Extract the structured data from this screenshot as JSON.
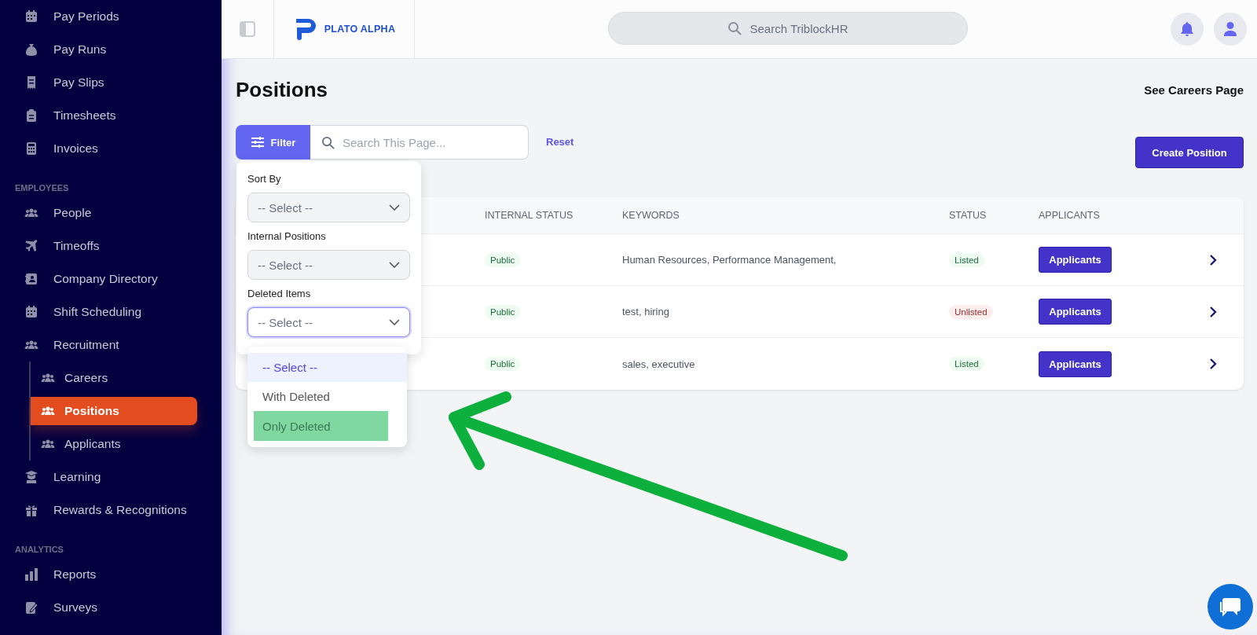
{
  "sidebar": {
    "sections": [
      {
        "items": [
          {
            "label": "Pay Periods",
            "selected": false
          },
          {
            "label": "Pay Runs",
            "selected": false
          },
          {
            "label": "Pay Slips",
            "selected": false
          },
          {
            "label": "Timesheets",
            "selected": false
          },
          {
            "label": "Invoices",
            "selected": false
          }
        ]
      },
      {
        "heading": "EMPLOYEES",
        "items": [
          {
            "label": "People",
            "selected": false
          },
          {
            "label": "Timeoffs",
            "selected": false
          },
          {
            "label": "Company Directory",
            "selected": false
          },
          {
            "label": "Shift Scheduling",
            "selected": false
          },
          {
            "label": "Recruitment",
            "selected": false,
            "expanded": true,
            "children": [
              {
                "label": "Careers",
                "selected": false
              },
              {
                "label": "Positions",
                "selected": true
              },
              {
                "label": "Applicants",
                "selected": false
              }
            ]
          },
          {
            "label": "Learning",
            "selected": false
          },
          {
            "label": "Rewards & Recognitions",
            "selected": false
          }
        ]
      },
      {
        "heading": "ANALYTICS",
        "items": [
          {
            "label": "Reports",
            "selected": false
          },
          {
            "label": "Surveys",
            "selected": false
          }
        ]
      }
    ]
  },
  "header": {
    "logo_text": "PLATO ALPHA",
    "search": {
      "placeholder": "Search TriblockHR"
    }
  },
  "page": {
    "title": "Positions",
    "careers_link": "See Careers Page"
  },
  "toolbar": {
    "filter_button": "Filter",
    "search": {
      "placeholder": "Search This Page..."
    },
    "reset": "Reset",
    "create_button": "Create Position"
  },
  "filter_panel": {
    "fields": [
      {
        "label": "Sort By",
        "value": "-- Select --",
        "focused": false
      },
      {
        "label": "Internal Positions",
        "value": "-- Select --",
        "focused": false
      },
      {
        "label": "Deleted Items",
        "value": "-- Select --",
        "focused": true
      }
    ],
    "options": [
      {
        "label": "-- Select --",
        "selected": true,
        "highlighted": false
      },
      {
        "label": "With Deleted",
        "selected": false,
        "highlighted": false
      },
      {
        "label": "Only Deleted",
        "selected": false,
        "highlighted": true
      }
    ]
  },
  "table": {
    "columns": [
      "INTERNAL STATUS",
      "KEYWORDS",
      "STATUS",
      "APPLICANTS"
    ],
    "rows": [
      {
        "internal_status": "Public",
        "keywords": "Human Resources, Performance Management,",
        "status": "Listed",
        "listed": true,
        "action": "Applicants"
      },
      {
        "internal_status": "Public",
        "keywords": "test, hiring",
        "status": "Unlisted",
        "listed": false,
        "action": "Applicants"
      },
      {
        "internal_status": "Public",
        "keywords": "sales, executive",
        "status": "Listed",
        "listed": true,
        "action": "Applicants"
      }
    ]
  }
}
